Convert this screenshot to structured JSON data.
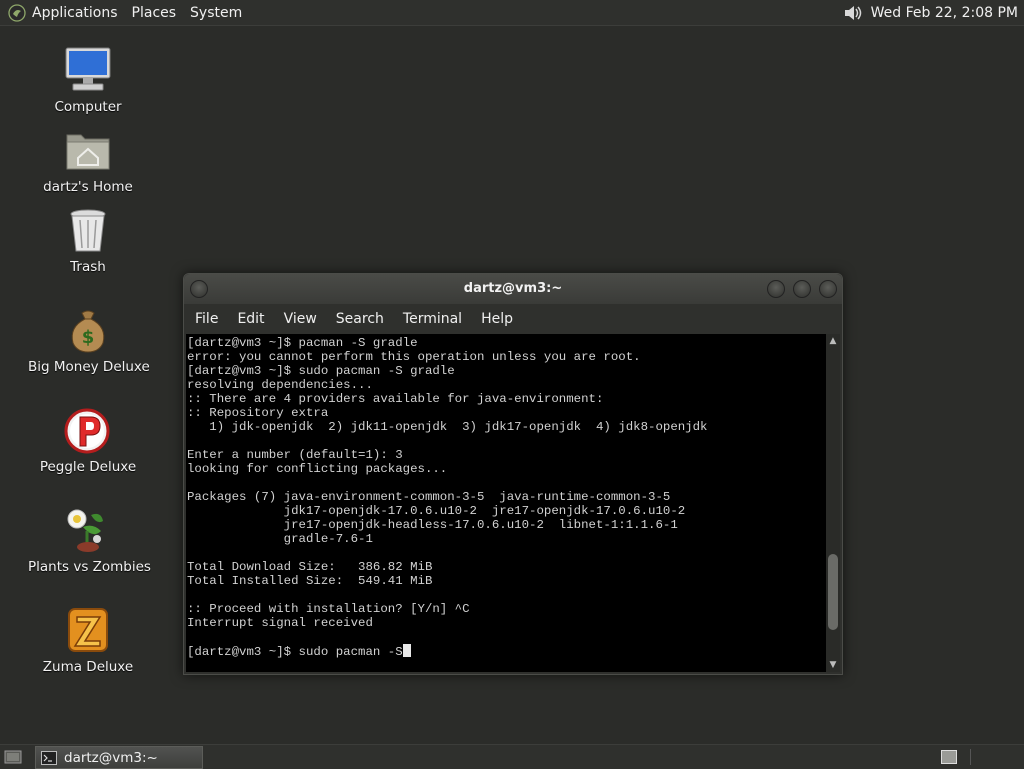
{
  "top_panel": {
    "menus": [
      "Applications",
      "Places",
      "System"
    ],
    "clock": "Wed Feb 22,  2:08 PM",
    "icons": {
      "logo": "gnome-foot-icon",
      "volume": "speaker-volume-icon"
    }
  },
  "desktop": {
    "icons": [
      {
        "label": "Computer",
        "icon": "computer-monitor-icon"
      },
      {
        "label": "dartz's Home",
        "icon": "home-folder-icon"
      },
      {
        "label": "Trash",
        "icon": "trash-can-icon"
      },
      {
        "label": "Big Money Deluxe",
        "icon": "money-bag-icon"
      },
      {
        "label": "Peggle Deluxe",
        "icon": "peggle-ball-icon"
      },
      {
        "label": "Plants vs Zombies",
        "icon": "plant-flower-icon"
      },
      {
        "label": "Zuma Deluxe",
        "icon": "zuma-z-icon"
      }
    ]
  },
  "terminal": {
    "title": "dartz@vm3:~",
    "menus": [
      "File",
      "Edit",
      "View",
      "Search",
      "Terminal",
      "Help"
    ],
    "lines": [
      "[dartz@vm3 ~]$ pacman -S gradle",
      "error: you cannot perform this operation unless you are root.",
      "[dartz@vm3 ~]$ sudo pacman -S gradle",
      "resolving dependencies...",
      ":: There are 4 providers available for java-environment:",
      ":: Repository extra",
      "   1) jdk-openjdk  2) jdk11-openjdk  3) jdk17-openjdk  4) jdk8-openjdk",
      "",
      "Enter a number (default=1): 3",
      "looking for conflicting packages...",
      "",
      "Packages (7) java-environment-common-3-5  java-runtime-common-3-5",
      "             jdk17-openjdk-17.0.6.u10-2  jre17-openjdk-17.0.6.u10-2",
      "             jre17-openjdk-headless-17.0.6.u10-2  libnet-1:1.1.6-1",
      "             gradle-7.6-1",
      "",
      "Total Download Size:   386.82 MiB",
      "Total Installed Size:  549.41 MiB",
      "",
      ":: Proceed with installation? [Y/n] ^C",
      "Interrupt signal received",
      "",
      "[dartz@vm3 ~]$ sudo pacman -S"
    ],
    "scrollbar": {
      "position_fraction": 0.88
    }
  },
  "bottom_panel": {
    "task_label": "dartz@vm3:~",
    "icons": {
      "show_desktop": "show-desktop-icon",
      "task": "terminal-icon",
      "workspace": "workspace-switcher-icon"
    }
  },
  "colors": {
    "desktop_bg": "#2b2c29",
    "panel_bg": "#2f302d",
    "terminal_bg": "#000000",
    "terminal_fg": "#d2d2d2"
  }
}
